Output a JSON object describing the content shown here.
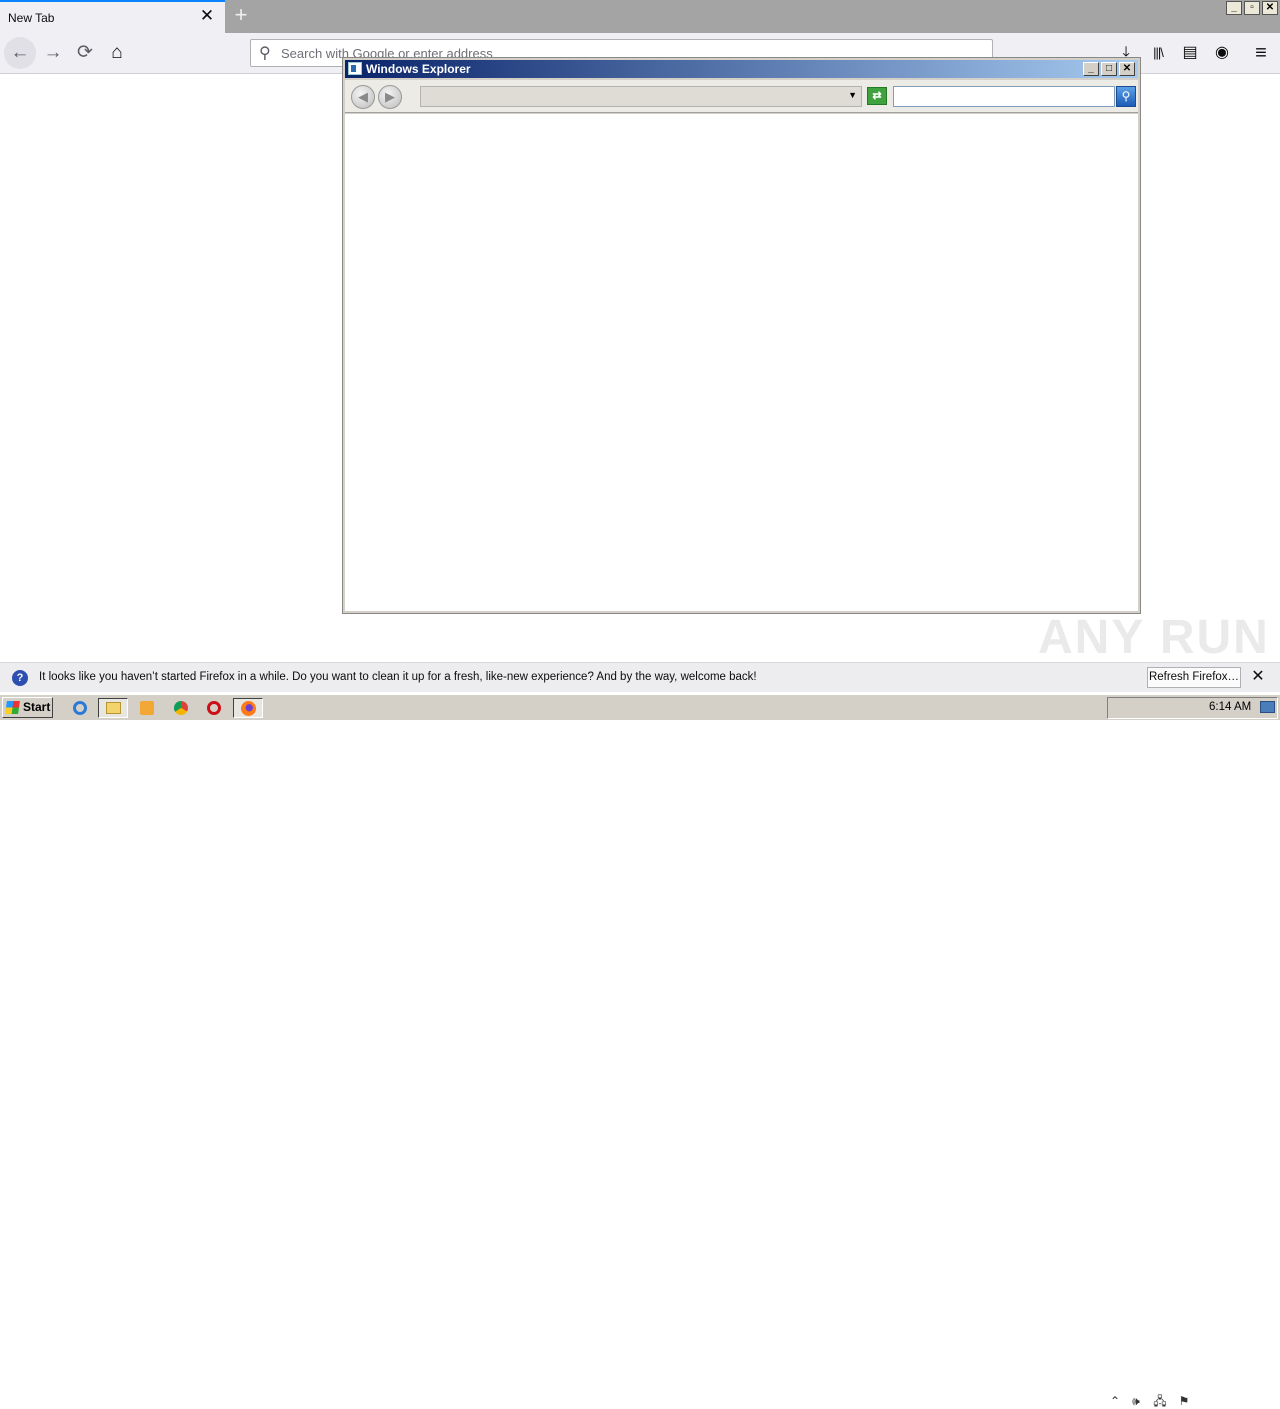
{
  "browser": {
    "tab": {
      "title": "New Tab",
      "close_icon": "close-icon"
    },
    "new_tab_symbol": "+",
    "window_caption": {
      "minimize": "_",
      "restore": "▫",
      "close": "✕"
    },
    "nav": {
      "back": "←",
      "forward": "→",
      "reload": "⟳",
      "home": "⌂"
    },
    "urlbar": {
      "placeholder": "Search with Google or enter address",
      "value": "",
      "icon": "search-icon"
    },
    "toolbar_icons": [
      "download-icon",
      "library-icon",
      "sidebar-icon",
      "account-icon",
      "menu-icon"
    ],
    "toolbar_glyphs": {
      "download": "⤓",
      "library": "|||\\",
      "sidebar": "▤",
      "account": "◉",
      "menu": "≡"
    }
  },
  "explorer_window": {
    "title": "Windows Explorer",
    "caption": {
      "minimize": "_",
      "maximize": "□",
      "close": "✕"
    },
    "nav": {
      "back": "◀",
      "forward": "▶"
    },
    "address_value": "",
    "address_dropdown": "▼",
    "go_symbol": "⇄",
    "search_value": "",
    "search_symbol": "⚲"
  },
  "watermark": "ANY RUN",
  "notification": {
    "icon": "?",
    "text": "It looks like you haven’t started Firefox in a while. Do you want to clean it up for a fresh, like-new experience? And by the way, welcome back!",
    "button": "Refresh Firefox…",
    "close": "✕"
  },
  "taskbar": {
    "start_label": "Start",
    "apps": [
      "internet-explorer-icon",
      "file-explorer-icon",
      "media-player-icon",
      "chrome-icon",
      "opera-icon",
      "firefox-icon"
    ],
    "tray_glyphs": {
      "expand": "⌃",
      "volume": "🕪",
      "network": "🖧",
      "flag": "⚑"
    },
    "clock": "6:14 AM"
  },
  "colors": {
    "accent_tab": "#0a84ff",
    "explorer_title_start": "#0a246a",
    "explorer_title_end": "#a6caf0",
    "taskbar": "#d4d0c8"
  }
}
